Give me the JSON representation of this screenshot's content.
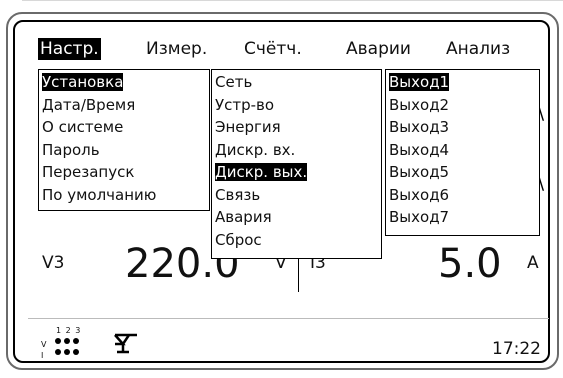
{
  "menu_bar": {
    "items": [
      "Настр.",
      "Измер.",
      "Счётч.",
      "Аварии",
      "Анализ"
    ],
    "active": "Настр."
  },
  "settings_menu": {
    "items": [
      "Установка",
      "Дата/Время",
      "О системе",
      "Пароль",
      "Перезапуск",
      "По умолчанию"
    ],
    "active": "Установка"
  },
  "setup_submenu": {
    "items": [
      "Сеть",
      "Устр-во",
      "Энергия",
      "Дискр. вх.",
      "Дискр. вых.",
      "Связь",
      "Авария",
      "Сброс"
    ],
    "active": "Дискр. вых."
  },
  "outputs_submenu": {
    "items": [
      "Выход1",
      "Выход2",
      "Выход3",
      "Выход4",
      "Выход5",
      "Выход6",
      "Выход7"
    ],
    "active": "Выход1"
  },
  "readings": {
    "voltage_label": "V3",
    "voltage_value": "220.0",
    "voltage_unit": "V",
    "current_label": "I3",
    "current_value": "5.0",
    "current_unit": "A"
  },
  "status_bar": {
    "phase_digits": "1 2 3",
    "row_labels": [
      "V",
      "I"
    ],
    "icon": "antenna-signal-icon",
    "time": "17:22"
  },
  "colors": {
    "highlight_bg": "#000000",
    "highlight_fg": "#ffffff",
    "bezel": "#6a6a6a"
  }
}
